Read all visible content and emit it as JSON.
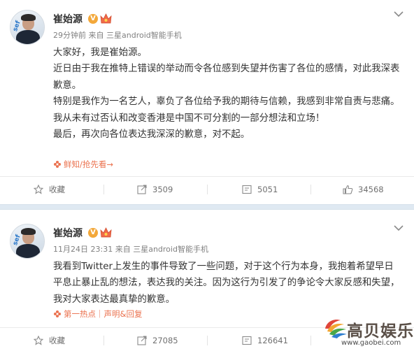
{
  "posts": [
    {
      "user": {
        "name": "崔始源",
        "verified_glyph": "V"
      },
      "meta": {
        "time": "29分钟前",
        "source": "来自 三星android智能手机"
      },
      "paragraphs": [
        "大家好，我是崔始源。",
        "近日由于我在推特上错误的举动而令各位感到失望并伤害了各位的感情，对此我深表歉意。",
        "特别是我作为一名艺人，辜负了各位给予我的期待与信赖，我感到非常自责与悲痛。",
        "我从未有过否认和改变香港是中国不可分割的一部分想法和立场！",
        "最后，再次向各位表达我深深的歉意，对不起。"
      ],
      "tag_text": "鲜知/抢先看→",
      "actions": {
        "favorite": "收藏",
        "forward": "3509",
        "comment": "5051",
        "like": "34568"
      }
    },
    {
      "user": {
        "name": "崔始源",
        "verified_glyph": "V"
      },
      "meta": {
        "time": "11月24日 23:31",
        "source": "来自 三星android智能手机"
      },
      "paragraphs": [
        "我看到Twitter上发生的事件导致了一些问题，对于这个行为本身，我抱着希望早日平息止暴止乱的想法，表达我的关注。因为这行为引发了的争论令大家反感和失望，我对大家表达最真挚的歉意。"
      ],
      "tag_text": "第一热点｜声明&回复",
      "actions": {
        "favorite": "收藏",
        "forward": "27085",
        "comment": "126641",
        "like": ""
      }
    }
  ],
  "watermark": {
    "logo": "高贝娱乐",
    "url": "www.gaobei.com"
  },
  "colors": {
    "accent": "#eb7350",
    "verified": "#f3a83a",
    "separator": "#dfe9f2",
    "text": "#333333",
    "meta": "#808080"
  }
}
